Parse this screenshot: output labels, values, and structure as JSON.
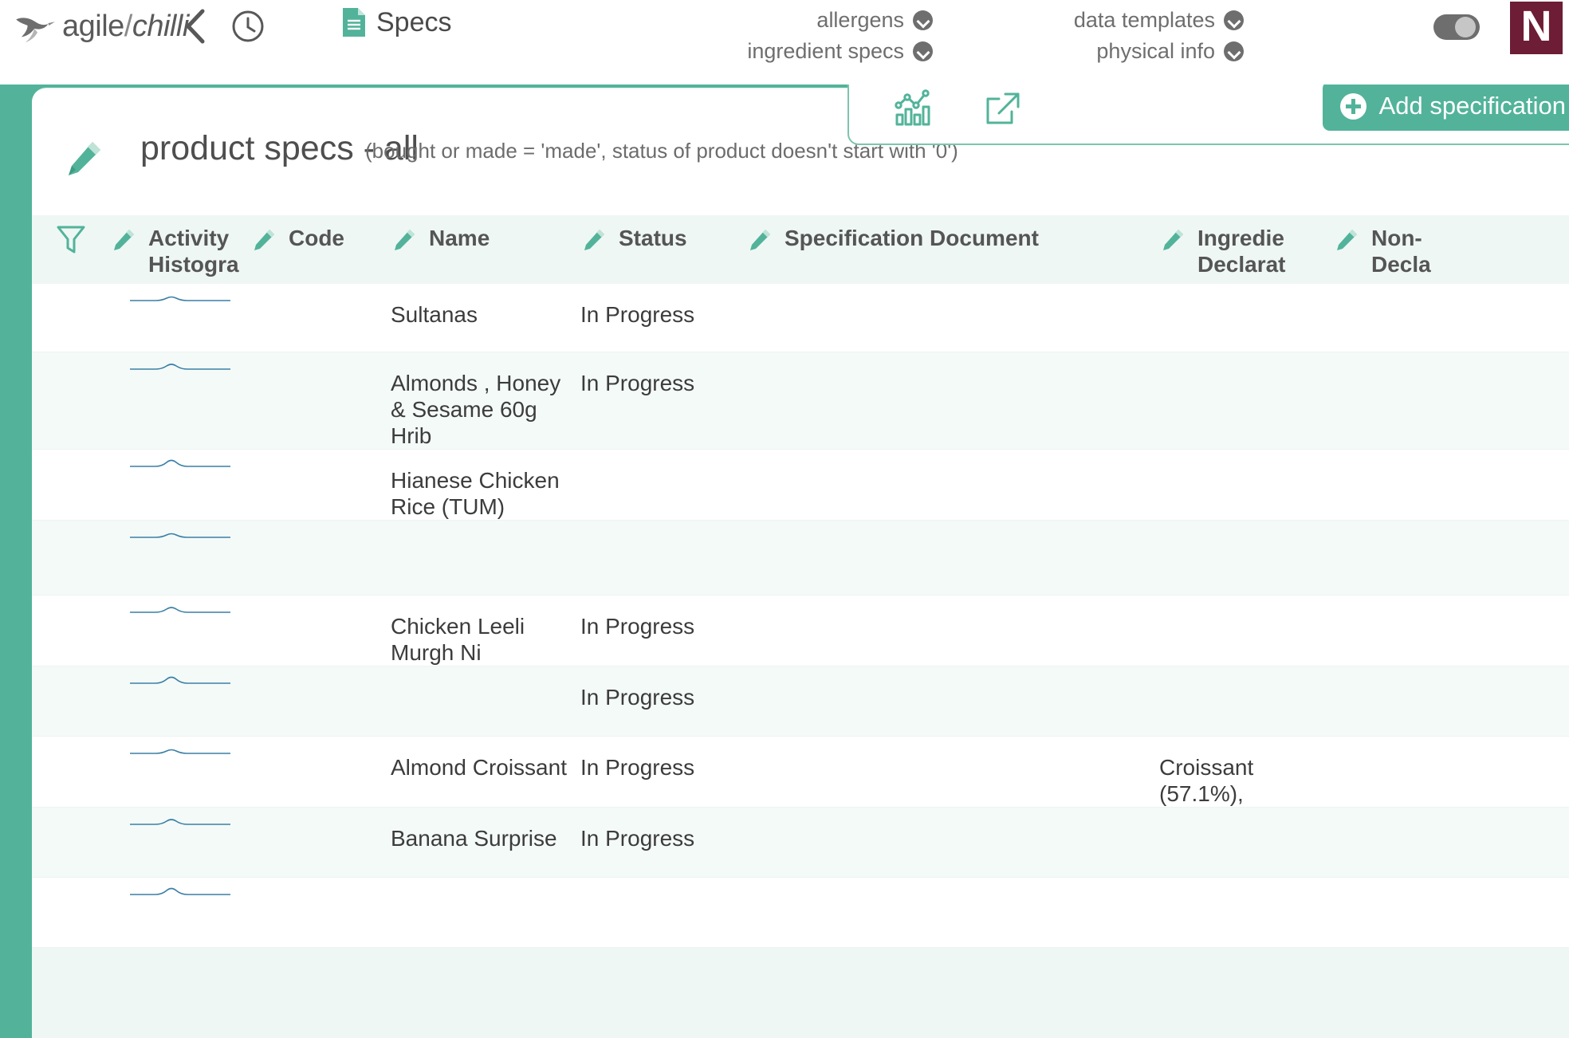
{
  "topbar": {
    "logo_text_agile": "agile",
    "logo_slash": "/",
    "logo_text_chilli": "chilli",
    "bird_icon": "bird-icon",
    "back_icon": "chevron-left-icon",
    "history_icon": "clock-icon",
    "specs_tab_label": "Specs",
    "specs_tab_icon": "document-icon",
    "nav_items": [
      {
        "label": "allergens",
        "icon": "chevron-down-circle-icon"
      },
      {
        "label": "ingredient specs",
        "icon": "chevron-down-circle-icon"
      },
      {
        "label": "data templates",
        "icon": "chevron-down-circle-icon"
      },
      {
        "label": "physical info",
        "icon": "chevron-down-circle-icon"
      }
    ],
    "toggle": {
      "name": "theme-toggle",
      "state": "on"
    },
    "brand_badge": "N",
    "brand_badge_color": "#6d1d35"
  },
  "page": {
    "edit_icon": "pencil-icon",
    "title": "product specs - all",
    "subtitle": "(bought or made = 'made', status of product doesn't start with '0')",
    "accent_color": "#52b39a",
    "background_color": "#52b39a"
  },
  "action_panel": {
    "chart_icon": "bar-chart-icon",
    "export_icon": "external-link-icon",
    "add_button_label": "Add specification",
    "add_button_icon": "plus-circle-icon"
  },
  "table": {
    "filter_icon": "filter-icon",
    "columns": [
      {
        "label": "Activity\nHistogra",
        "edit_icon": "pencil-icon"
      },
      {
        "label": "Code",
        "edit_icon": "pencil-icon"
      },
      {
        "label": "Name",
        "edit_icon": "pencil-icon"
      },
      {
        "label": "Status",
        "edit_icon": "pencil-icon"
      },
      {
        "label": "Specification Document",
        "edit_icon": "pencil-icon"
      },
      {
        "label": "Ingredie\nDeclarat",
        "edit_icon": "pencil-icon"
      },
      {
        "label": "Non-\nDecla",
        "edit_icon": "pencil-icon"
      }
    ],
    "rows": [
      {
        "code": "",
        "name": "Sultanas",
        "status": "In Progress",
        "document": "",
        "ingredient_declaration": "",
        "non_declaration": ""
      },
      {
        "code": "",
        "name": "Almonds , Honey & Sesame 60g Hrib",
        "status": "In Progress",
        "document": "",
        "ingredient_declaration": "",
        "non_declaration": ""
      },
      {
        "code": "",
        "name": "Hianese Chicken Rice (TUM)",
        "status": "",
        "document": "",
        "ingredient_declaration": "",
        "non_declaration": ""
      },
      {
        "code": "",
        "name": "",
        "status": "",
        "document": "",
        "ingredient_declaration": "",
        "non_declaration": ""
      },
      {
        "code": "",
        "name": "Chicken Leeli Murgh Ni",
        "status": "In Progress",
        "document": "",
        "ingredient_declaration": "",
        "non_declaration": ""
      },
      {
        "code": "",
        "name": "",
        "status": "In Progress",
        "document": "",
        "ingredient_declaration": "",
        "non_declaration": ""
      },
      {
        "code": "",
        "name": "Almond Croissant",
        "status": "In Progress",
        "document": "",
        "ingredient_declaration": "Croissant (57.1%),",
        "non_declaration": ""
      },
      {
        "code": "",
        "name": "Banana Surprise",
        "status": "In Progress",
        "document": "",
        "ingredient_declaration": "",
        "non_declaration": ""
      },
      {
        "code": "",
        "name": "",
        "status": "",
        "document": "",
        "ingredient_declaration": "",
        "non_declaration": ""
      }
    ],
    "sparkline_color": "#3b7fa6"
  }
}
